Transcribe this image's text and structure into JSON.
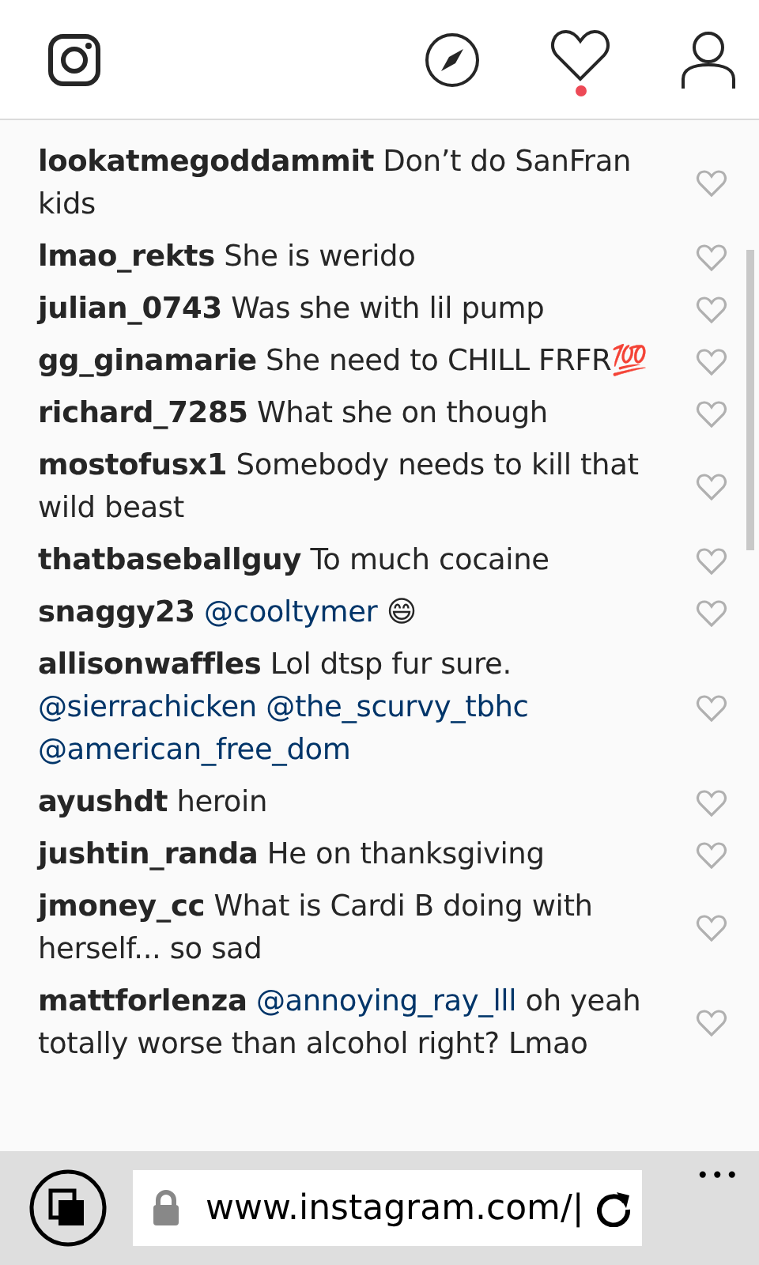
{
  "header": {
    "notification_dot": true
  },
  "comments": [
    {
      "user": "lookatmegoddammit",
      "parts": [
        {
          "kind": "text",
          "text": "Don’t do SanFran kids"
        }
      ]
    },
    {
      "user": "lmao_rekts",
      "parts": [
        {
          "kind": "text",
          "text": "She is werido"
        }
      ]
    },
    {
      "user": "julian_0743",
      "parts": [
        {
          "kind": "text",
          "text": "Was she with lil pump"
        }
      ]
    },
    {
      "user": "gg_ginamarie",
      "parts": [
        {
          "kind": "text",
          "text": "She need to CHILL FRFR💯"
        }
      ]
    },
    {
      "user": "richard_7285",
      "parts": [
        {
          "kind": "text",
          "text": "What she on though"
        }
      ]
    },
    {
      "user": "mostofusx1",
      "parts": [
        {
          "kind": "text",
          "text": "Somebody needs to kill that wild beast"
        }
      ]
    },
    {
      "user": "thatbaseballguy",
      "parts": [
        {
          "kind": "text",
          "text": "To much cocaine"
        }
      ]
    },
    {
      "user": "snaggy23",
      "parts": [
        {
          "kind": "mention",
          "text": "@cooltymer"
        },
        {
          "kind": "text",
          "text": "😄"
        }
      ]
    },
    {
      "user": "allisonwaffles",
      "parts": [
        {
          "kind": "text",
          "text": "Lol dtsp fur sure."
        },
        {
          "kind": "mention",
          "text": "@sierrachicken"
        },
        {
          "kind": "mention",
          "text": "@the_scurvy_tbhc"
        },
        {
          "kind": "mention",
          "text": "@american_free_dom"
        }
      ]
    },
    {
      "user": "ayushdt",
      "parts": [
        {
          "kind": "text",
          "text": "heroin"
        }
      ]
    },
    {
      "user": "jushtin_randa",
      "parts": [
        {
          "kind": "text",
          "text": "He on thanksgiving"
        }
      ]
    },
    {
      "user": "jmoney_cc",
      "parts": [
        {
          "kind": "text",
          "text": "What is Cardi B doing with herself... so sad"
        }
      ]
    },
    {
      "user": "mattforlenza",
      "parts": [
        {
          "kind": "mention",
          "text": "@annoying_ray_lll"
        },
        {
          "kind": "text",
          "text": "oh yeah totally worse than alcohol right? Lmao"
        }
      ]
    }
  ],
  "browser_bar": {
    "url": "www.instagram.com/|",
    "more": "•••"
  }
}
